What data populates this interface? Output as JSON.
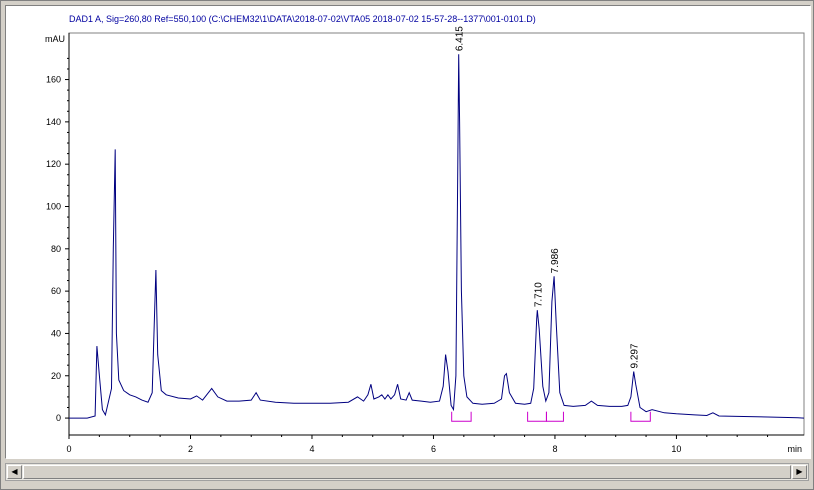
{
  "signal_header": "DAD1 A, Sig=260,80 Ref=550,100 (C:\\CHEM32\\1\\DATA\\2018-07-02\\VTA05 2018-07-02 15-57-28--1377\\001-0101.D)",
  "colors": {
    "trace": "#000080",
    "baseline": "#cc00cc",
    "header": "#0000a0"
  },
  "scrollbar": {
    "left_icon": "arrow-left-icon",
    "right_icon": "arrow-right-icon"
  },
  "chart_data": {
    "type": "line",
    "ylabel": "mAU",
    "xlabel": "min",
    "xlim": [
      0,
      12.1
    ],
    "ylim": [
      -8,
      182
    ],
    "x_ticks": [
      0,
      2,
      4,
      6,
      8,
      10
    ],
    "y_ticks": [
      0,
      20,
      40,
      60,
      80,
      100,
      120,
      140,
      160
    ],
    "grid": false,
    "series": [
      {
        "values": [
          [
            0.0,
            0.0
          ],
          [
            0.3,
            0.0
          ],
          [
            0.43,
            1.0
          ],
          [
            0.46,
            34.0
          ],
          [
            0.5,
            20.0
          ],
          [
            0.55,
            4.0
          ],
          [
            0.6,
            1.5
          ],
          [
            0.7,
            14.0
          ],
          [
            0.73,
            80.0
          ],
          [
            0.76,
            127.0
          ],
          [
            0.78,
            40.0
          ],
          [
            0.82,
            18.0
          ],
          [
            0.9,
            13.0
          ],
          [
            1.0,
            11.0
          ],
          [
            1.1,
            10.0
          ],
          [
            1.2,
            8.5
          ],
          [
            1.3,
            7.5
          ],
          [
            1.37,
            12.0
          ],
          [
            1.41,
            50.0
          ],
          [
            1.43,
            70.0
          ],
          [
            1.46,
            30.0
          ],
          [
            1.52,
            13.0
          ],
          [
            1.6,
            11.0
          ],
          [
            1.8,
            9.5
          ],
          [
            2.0,
            9.0
          ],
          [
            2.1,
            10.5
          ],
          [
            2.2,
            8.5
          ],
          [
            2.35,
            14.0
          ],
          [
            2.45,
            10.0
          ],
          [
            2.6,
            8.0
          ],
          [
            2.8,
            8.0
          ],
          [
            3.0,
            8.5
          ],
          [
            3.08,
            12.0
          ],
          [
            3.15,
            8.5
          ],
          [
            3.4,
            7.5
          ],
          [
            3.7,
            7.0
          ],
          [
            4.0,
            7.0
          ],
          [
            4.3,
            7.0
          ],
          [
            4.6,
            7.5
          ],
          [
            4.75,
            10.0
          ],
          [
            4.85,
            8.0
          ],
          [
            4.92,
            11.0
          ],
          [
            4.97,
            16.0
          ],
          [
            5.02,
            9.0
          ],
          [
            5.1,
            10.0
          ],
          [
            5.15,
            11.0
          ],
          [
            5.2,
            9.0
          ],
          [
            5.25,
            11.0
          ],
          [
            5.3,
            9.0
          ],
          [
            5.36,
            11.0
          ],
          [
            5.41,
            16.0
          ],
          [
            5.46,
            9.0
          ],
          [
            5.55,
            8.5
          ],
          [
            5.6,
            12.0
          ],
          [
            5.65,
            8.5
          ],
          [
            5.8,
            8.0
          ],
          [
            5.95,
            7.5
          ],
          [
            6.1,
            8.0
          ],
          [
            6.16,
            15.0
          ],
          [
            6.2,
            30.0
          ],
          [
            6.24,
            22.0
          ],
          [
            6.29,
            6.0
          ],
          [
            6.33,
            4.0
          ],
          [
            6.37,
            20.0
          ],
          [
            6.4,
            120.0
          ],
          [
            6.415,
            172.0
          ],
          [
            6.43,
            140.0
          ],
          [
            6.46,
            60.0
          ],
          [
            6.5,
            20.0
          ],
          [
            6.55,
            10.0
          ],
          [
            6.65,
            7.0
          ],
          [
            6.8,
            6.5
          ],
          [
            7.0,
            7.0
          ],
          [
            7.12,
            9.0
          ],
          [
            7.17,
            20.0
          ],
          [
            7.2,
            21.0
          ],
          [
            7.25,
            12.0
          ],
          [
            7.35,
            7.0
          ],
          [
            7.5,
            6.5
          ],
          [
            7.6,
            7.0
          ],
          [
            7.65,
            14.0
          ],
          [
            7.7,
            47.0
          ],
          [
            7.71,
            51.0
          ],
          [
            7.74,
            42.0
          ],
          [
            7.8,
            15.0
          ],
          [
            7.85,
            8.0
          ],
          [
            7.9,
            12.0
          ],
          [
            7.95,
            55.0
          ],
          [
            7.986,
            67.0
          ],
          [
            8.02,
            45.0
          ],
          [
            8.08,
            12.0
          ],
          [
            8.15,
            6.0
          ],
          [
            8.3,
            5.5
          ],
          [
            8.5,
            6.0
          ],
          [
            8.6,
            8.0
          ],
          [
            8.7,
            6.0
          ],
          [
            8.9,
            5.5
          ],
          [
            9.1,
            5.5
          ],
          [
            9.2,
            6.0
          ],
          [
            9.25,
            10.0
          ],
          [
            9.297,
            22.0
          ],
          [
            9.33,
            16.0
          ],
          [
            9.4,
            5.0
          ],
          [
            9.5,
            3.0
          ],
          [
            9.6,
            4.0
          ],
          [
            9.8,
            2.5
          ],
          [
            10.0,
            2.0
          ],
          [
            10.3,
            1.5
          ],
          [
            10.5,
            1.2
          ],
          [
            10.6,
            2.5
          ],
          [
            10.7,
            1.0
          ],
          [
            11.0,
            0.8
          ],
          [
            11.5,
            0.5
          ],
          [
            12.0,
            0.2
          ],
          [
            12.1,
            0.0
          ]
        ]
      }
    ],
    "peaks": [
      {
        "rt": 6.415,
        "label": "6.415",
        "height": 172,
        "baseline_start": 6.3,
        "baseline_end": 6.62
      },
      {
        "rt": 7.71,
        "label": "7.710",
        "height": 51,
        "baseline_start": 7.55,
        "baseline_end": 7.86
      },
      {
        "rt": 7.986,
        "label": "7.986",
        "height": 67,
        "baseline_start": 7.86,
        "baseline_end": 8.14
      },
      {
        "rt": 9.297,
        "label": "9.297",
        "height": 22,
        "baseline_start": 9.25,
        "baseline_end": 9.57
      }
    ]
  }
}
